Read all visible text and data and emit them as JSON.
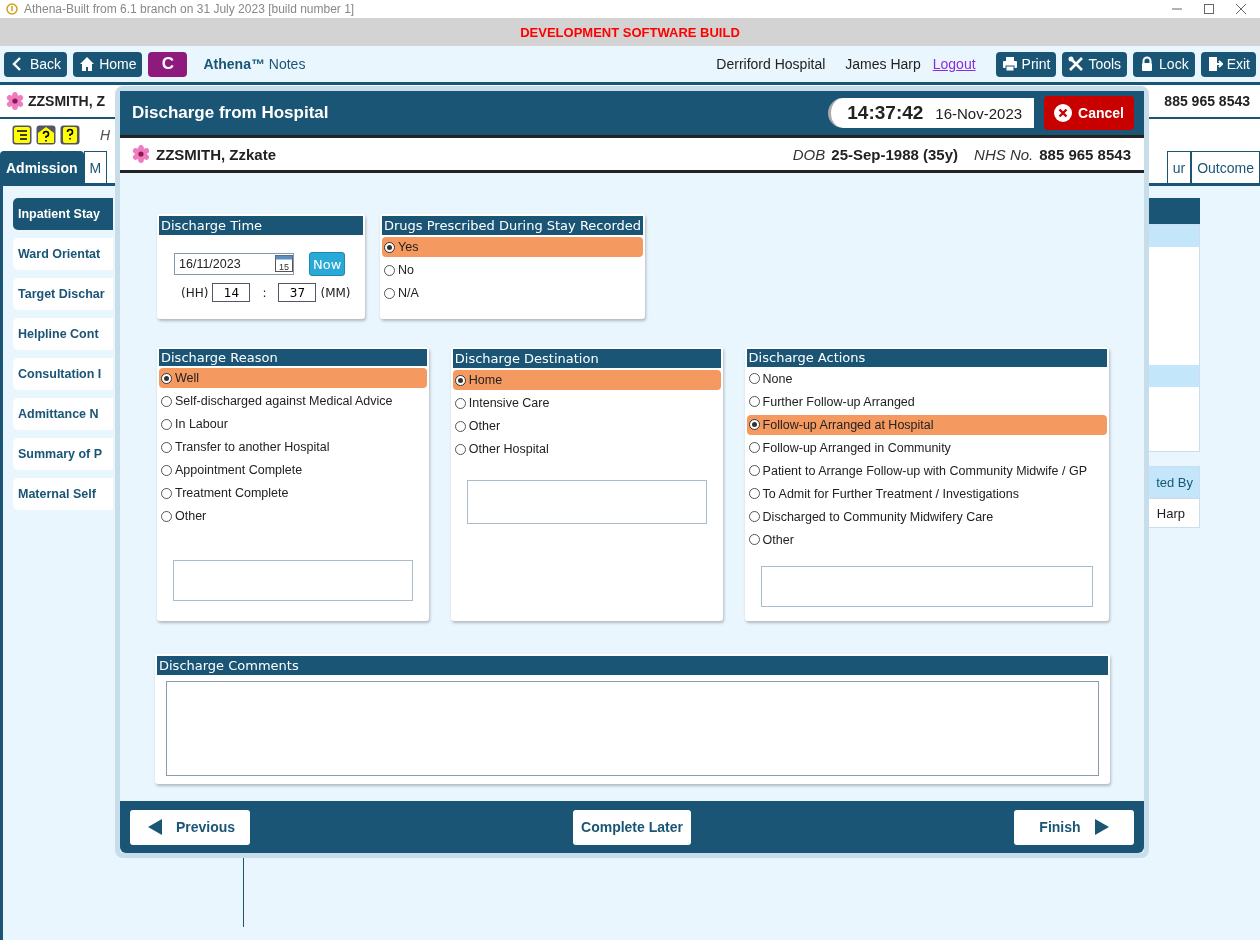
{
  "window": {
    "title": "Athena-Built from 6.1 branch on 31 July 2023 [build number 1]"
  },
  "banner": "DEVELOPMENT SOFTWARE BUILD",
  "toolbar": {
    "left_buttons": [
      {
        "label": "Back",
        "kind": "back"
      },
      {
        "label": "Home",
        "kind": "home"
      }
    ],
    "badge": "C",
    "app_name": "**Athena™** Notes",
    "hospital": "Derriford Hospital",
    "user": "James Harp",
    "logout": "Logout",
    "right_buttons": [
      {
        "label": "Print",
        "kind": "print"
      },
      {
        "label": "Tools",
        "kind": "tools"
      },
      {
        "label": "Lock",
        "kind": "lock"
      },
      {
        "label": "Exit",
        "kind": "exit"
      }
    ]
  },
  "patient_bar": {
    "name": "ZZSMITH, Z",
    "nhs_number": "885 965 8543"
  },
  "alert_row": {
    "text": "H"
  },
  "tabs": [
    {
      "label": "Admission",
      "selected": true
    },
    {
      "label": "M",
      "selected": false
    },
    {
      "label": "ur",
      "selected": false
    },
    {
      "label": "Outcome",
      "selected": false
    }
  ],
  "sidebar": {
    "items": [
      {
        "label": "Inpatient Stay",
        "selected": true
      },
      {
        "label": "Ward Orientat",
        "selected": false
      },
      {
        "label": "Target Dischar",
        "selected": false
      },
      {
        "label": "Helpline Cont",
        "selected": false
      },
      {
        "label": "Consultation I",
        "selected": false
      },
      {
        "label": "Admittance N",
        "selected": false
      },
      {
        "label": "Summary of P",
        "selected": false
      },
      {
        "label": "Maternal Self",
        "selected": false
      }
    ]
  },
  "side_table": {
    "column_header": "ted By",
    "cell": "Harp"
  },
  "dialog": {
    "title": "Discharge from Hospital",
    "time": "14:37:42",
    "date": "16-Nov-2023",
    "cancel": "Cancel",
    "patient": {
      "name": "ZZSMITH, Zzkate",
      "dob_label": "DOB",
      "dob": "25-Sep-1988 (35y)",
      "nhs_label": "NHS No.",
      "nhs_number": "885 965 8543"
    },
    "discharge_time": {
      "title": "Discharge Time",
      "date": "16/11/2023",
      "calendar_day": "15",
      "now": "Now",
      "hh_label": "(HH)",
      "hh": "14",
      "separator": ":",
      "mm": "37",
      "mm_label": "(MM)"
    },
    "drugs": {
      "title": "Drugs Prescribed During Stay Recorded",
      "options": [
        {
          "label": "Yes",
          "selected": true
        },
        {
          "label": "No",
          "selected": false
        },
        {
          "label": "N/A",
          "selected": false
        }
      ]
    },
    "groups": [
      {
        "title": "Discharge Reason",
        "options": [
          {
            "label": "Well",
            "selected": true
          },
          {
            "label": "Self-discharged against Medical Advice",
            "selected": false
          },
          {
            "label": "In Labour",
            "selected": false
          },
          {
            "label": "Transfer to another Hospital",
            "selected": false
          },
          {
            "label": "Appointment Complete",
            "selected": false
          },
          {
            "label": "Treatment Complete",
            "selected": false
          },
          {
            "label": "Other",
            "selected": false
          }
        ]
      },
      {
        "title": "Discharge Destination",
        "options": [
          {
            "label": "Home",
            "selected": true
          },
          {
            "label": "Intensive Care",
            "selected": false
          },
          {
            "label": "Other",
            "selected": false
          },
          {
            "label": "Other Hospital",
            "selected": false
          }
        ]
      },
      {
        "title": "Discharge Actions",
        "options": [
          {
            "label": "None",
            "selected": false
          },
          {
            "label": "Further Follow-up Arranged",
            "selected": false
          },
          {
            "label": "Follow-up Arranged at Hospital",
            "selected": true
          },
          {
            "label": "Follow-up Arranged in Community",
            "selected": false
          },
          {
            "label": "Patient to Arrange Follow-up with Community Midwife / GP",
            "selected": false
          },
          {
            "label": "To Admit for Further Treatment / Investigations",
            "selected": false
          },
          {
            "label": "Discharged to Community Midwifery Care",
            "selected": false
          },
          {
            "label": "Other",
            "selected": false
          }
        ]
      }
    ],
    "comments": {
      "title": "Discharge Comments"
    },
    "footer": {
      "previous": "Previous",
      "complete_later": "Complete Later",
      "finish": "Finish"
    }
  }
}
